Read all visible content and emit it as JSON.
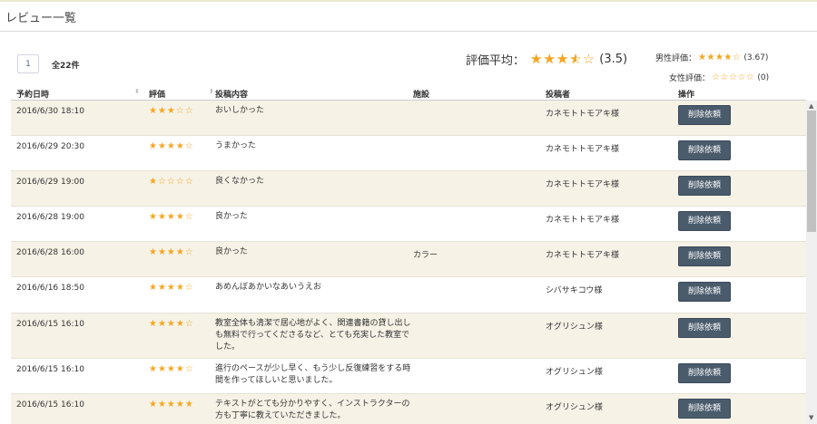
{
  "page_title": "レビュー一覧",
  "pager": {
    "current_page": "1",
    "total_label": "全22件"
  },
  "ratings": {
    "average_label": "評価平均：",
    "average_stars": "★★★★☆",
    "average_value": 3.5,
    "average_score": "(3.5)",
    "male_label": "男性評価：",
    "male_stars": "★★★★☆",
    "male_value": 3.67,
    "male_score": "(3.67)",
    "female_label": "女性評価：",
    "female_stars": "☆☆☆☆☆",
    "female_score": "(0)",
    "star_color": "#f5a623"
  },
  "table": {
    "headers": {
      "date": "予約日時",
      "rating": "評価",
      "content": "投稿内容",
      "facility": "施設",
      "poster": "投稿者",
      "action": "操作"
    },
    "sort_icon": "⬍",
    "rows": [
      {
        "date": "2016/6/30 18:10",
        "stars": "★★★☆☆",
        "content": "おいしかった",
        "facility": "",
        "poster": "カネモトトモアキ様",
        "action": "削除依頼"
      },
      {
        "date": "2016/6/29 20:30",
        "stars": "★★★★☆",
        "content": "うまかった",
        "facility": "",
        "poster": "カネモトトモアキ様",
        "action": "削除依頼"
      },
      {
        "date": "2016/6/29 19:00",
        "stars": "★☆☆☆☆",
        "content": "良くなかった",
        "facility": "",
        "poster": "カネモトトモアキ様",
        "action": "削除依頼"
      },
      {
        "date": "2016/6/28 19:00",
        "stars": "★★★★☆",
        "content": "良かった",
        "facility": "",
        "poster": "カネモトトモアキ様",
        "action": "削除依頼"
      },
      {
        "date": "2016/6/28 16:00",
        "stars": "★★★★☆",
        "content": "良かった",
        "facility": "カラー",
        "poster": "カネモトトモアキ様",
        "action": "削除依頼"
      },
      {
        "date": "2016/6/16 18:50",
        "stars": "★★★★☆",
        "content": "あめんぼあかいなあいうえお",
        "facility": "",
        "poster": "シバサキコウ様",
        "action": "削除依頼"
      },
      {
        "date": "2016/6/15 16:10",
        "stars": "★★★★☆",
        "content": "教室全体も清潔で居心地がよく、関連書籍の貸し出しも無料で行ってくださるなど、とても充実した教室でした。",
        "facility": "",
        "poster": "オグリシュン様",
        "action": "削除依頼"
      },
      {
        "date": "2016/6/15 16:10",
        "stars": "★★★★☆",
        "content": "進行のペースが少し早く、もう少し反復練習をする時間を作ってほしいと思いました。",
        "facility": "",
        "poster": "オグリシュン様",
        "action": "削除依頼"
      },
      {
        "date": "2016/6/15 16:10",
        "stars": "★★★★★",
        "content": "テキストがとても分かりやすく、インストラクターの方も丁寧に教えていただきました。",
        "facility": "",
        "poster": "オグリシュン様",
        "action": "削除依頼"
      }
    ]
  }
}
